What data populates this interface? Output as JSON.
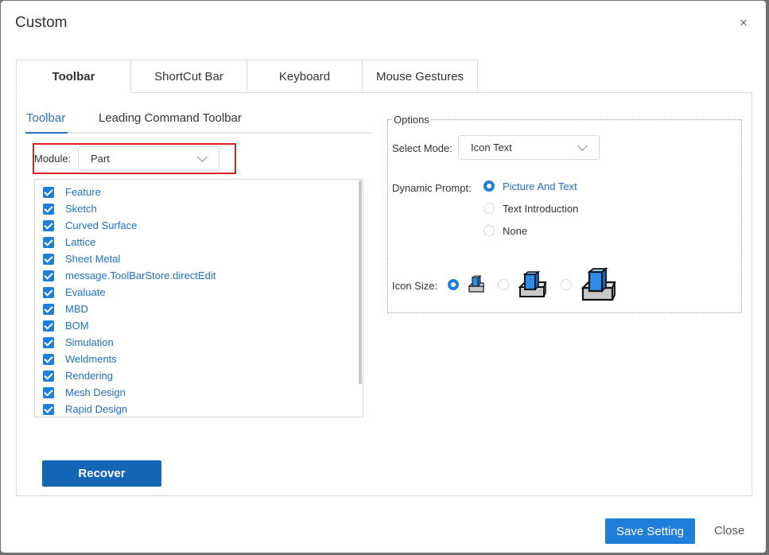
{
  "dialog": {
    "title": "Custom",
    "close_symbol": "×"
  },
  "tabs": [
    {
      "label": "Toolbar",
      "active": true
    },
    {
      "label": "ShortCut Bar",
      "active": false
    },
    {
      "label": "Keyboard",
      "active": false
    },
    {
      "label": "Mouse Gestures",
      "active": false
    }
  ],
  "subtabs": [
    {
      "label": "Toolbar",
      "active": true
    },
    {
      "label": "Leading Command Toolbar",
      "active": false
    }
  ],
  "module": {
    "label": "Module:",
    "value": "Part"
  },
  "toolbar_list": [
    {
      "label": "Feature",
      "checked": true
    },
    {
      "label": "Sketch",
      "checked": true
    },
    {
      "label": "Curved Surface",
      "checked": true
    },
    {
      "label": "Lattice",
      "checked": true
    },
    {
      "label": "Sheet Metal",
      "checked": true
    },
    {
      "label": "message.ToolBarStore.directEdit",
      "checked": true
    },
    {
      "label": "Evaluate",
      "checked": true
    },
    {
      "label": "MBD",
      "checked": true
    },
    {
      "label": "BOM",
      "checked": true
    },
    {
      "label": "Simulation",
      "checked": true
    },
    {
      "label": "Weldments",
      "checked": true
    },
    {
      "label": "Rendering",
      "checked": true
    },
    {
      "label": "Mesh Design",
      "checked": true
    },
    {
      "label": "Rapid Design",
      "checked": true
    }
  ],
  "recover_label": "Recover",
  "options": {
    "legend": "Options",
    "select_mode": {
      "label": "Select Mode:",
      "value": "Icon Text"
    },
    "dynamic_prompt": {
      "label": "Dynamic Prompt:",
      "choices": [
        {
          "label": "Picture And Text",
          "selected": true
        },
        {
          "label": "Text Introduction",
          "selected": false
        },
        {
          "label": "None",
          "selected": false
        }
      ]
    },
    "icon_size": {
      "label": "Icon Size:",
      "choices": [
        {
          "icon": "small-part-icon",
          "selected": true
        },
        {
          "icon": "medium-part-icon",
          "selected": false
        },
        {
          "icon": "large-part-icon",
          "selected": false
        }
      ]
    }
  },
  "footer": {
    "save_label": "Save Setting",
    "close_label": "Close"
  },
  "colors": {
    "accent": "#1f7ed9",
    "recover": "#1565b6",
    "highlight_box": "#e02020",
    "link_text": "#1f6fc2"
  }
}
